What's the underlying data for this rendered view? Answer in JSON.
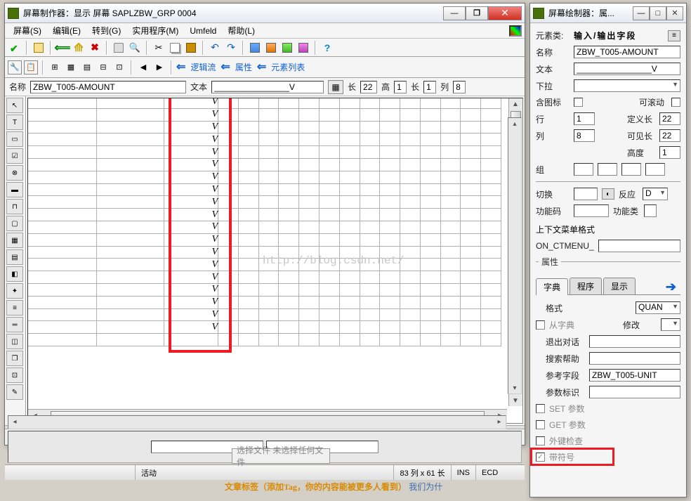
{
  "main": {
    "title": "屏幕制作器：显示 屏幕 SAPLZBW_GRP 0004",
    "menus": [
      "屏幕(S)",
      "编辑(E)",
      "转到(G)",
      "实用程序(M)",
      "Umfeld",
      "帮助(L)"
    ],
    "tb2": {
      "logic": "逻辑流",
      "attr": "属性",
      "elem": "元素列表"
    },
    "fields": {
      "name_l": "名称",
      "name_v": "ZBW_T005-AMOUNT",
      "text_l": "文本",
      "text_v": "________________V",
      "len_l": "长",
      "len_v": "22",
      "h_l": "高",
      "h_v": "1",
      "len2_l": "长",
      "len2_v": "1",
      "col_l": "列",
      "col_v": "8"
    },
    "v_char": "V",
    "status": {
      "active": "活动",
      "dim": "83 列 x 61 长",
      "ins": "INS",
      "ecd": "ECD"
    }
  },
  "prop": {
    "title": "屏幕绘制器：属...",
    "class_l": "元素类:",
    "class_v": "输入/输出字段",
    "name_l": "名称",
    "name_v": "ZBW_T005-AMOUNT",
    "text_l": "文本",
    "text_v": "________________V",
    "drop_l": "下拉",
    "icon_l": "含图标",
    "scroll_l": "可滚动",
    "row_l": "行",
    "row_v": "1",
    "deflen_l": "定义长",
    "deflen_v": "22",
    "col_l": "列",
    "col_v": "8",
    "vislen_l": "可见长",
    "vislen_v": "22",
    "height_l": "高度",
    "height_v": "1",
    "group_l": "组",
    "switch_l": "切换",
    "react_l": "反应",
    "react_v": "D",
    "fcode_l": "功能码",
    "ftype_l": "功能类",
    "ctx_l": "上下文菜单格式",
    "ctx_v": "ON_CTMENU_",
    "tabs": [
      "字典",
      "程序",
      "显示"
    ],
    "fmt_l": "格式",
    "fmt_v": "QUAN",
    "fromdict_l": "从字典",
    "mod_l": "修改",
    "exit_l": "退出对话",
    "shelp_l": "搜索帮助",
    "ref_l": "参考字段",
    "ref_v": "ZBW_T005-UNIT",
    "param_l": "参数标识",
    "set_l": "SET 参数",
    "get_l": "GET 参数",
    "fk_l": "外键检查",
    "sign_l": "带符号",
    "attr_grp": "属性"
  },
  "below": {
    "file": "选择文件  未选择任何文件",
    "tag_l": "文章标签（添加Tag，你的内容能被更多人看到）",
    "tag_r": "我们为什"
  },
  "watermark": "http://blog.csdn.net/"
}
